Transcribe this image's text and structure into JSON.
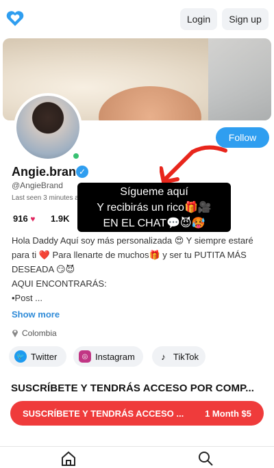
{
  "header": {
    "login_label": "Login",
    "signup_label": "Sign up",
    "logo_icon": "heart-logo-icon"
  },
  "profile": {
    "name": "Angie.brand",
    "handle": "@AngieBrand",
    "last_seen": "Last seen 3 minutes ago",
    "follow_label": "Follow",
    "stats": {
      "posts": "916",
      "likes": "1.9K"
    }
  },
  "overlay": {
    "line1": "Sígueme aquí",
    "line2": "Y recibirás un rico🎁🎥",
    "line3": "EN EL CHAT💬😈🥵"
  },
  "bio": {
    "line1": "Hola Daddy Aquí soy más personalizada 😍 Y siempre estaré para ti ❤️ Para llenarte de muchos🎁 y ser tu PUTITA MÁS DESEADA 😏😈",
    "line2": "AQUI ENCONTRARÁS:",
    "line3": "•Post ...",
    "show_more": "Show more"
  },
  "location": "Colombia",
  "socials": [
    {
      "label": "Twitter",
      "color": "#1d9bf0"
    },
    {
      "label": "Instagram",
      "color": "#c13584"
    },
    {
      "label": "TikTok",
      "color": "#000000"
    }
  ],
  "subscription": {
    "heading": "SUSCRÍBETE Y TENDRÁS ACCESO POR COMP...",
    "button_text": "SUSCRÍBETE Y TENDRÁS ACCESO ...",
    "price": "1 Month $5",
    "accent": "#ef3b3b"
  },
  "nav": {
    "home_icon": "home-icon",
    "search_icon": "search-icon"
  }
}
